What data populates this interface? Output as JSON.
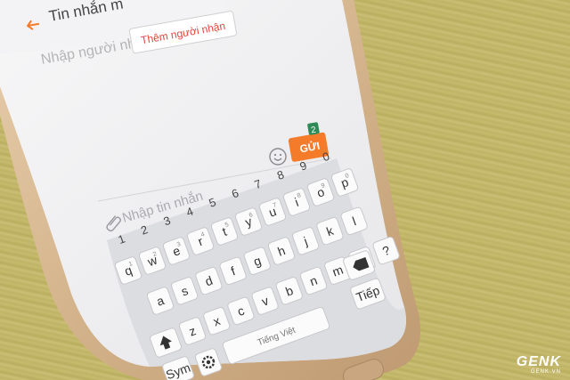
{
  "app": {
    "header_title": "Tin nhắn m",
    "back_icon": "arrow-left-icon"
  },
  "recipient": {
    "placeholder": "Nhập người nhận",
    "tooltip": "Thêm người nhận"
  },
  "compose": {
    "placeholder": "Nhập tin nhắn",
    "send_label": "GỬI",
    "send_badge": "2",
    "emoji_icon": "smiley-icon",
    "attach_icon": "paperclip-icon"
  },
  "keyboard": {
    "number_row": [
      "1",
      "2",
      "3",
      "4",
      "5",
      "6",
      "7",
      "8",
      "9",
      "0"
    ],
    "row1": [
      "q",
      "w",
      "e",
      "r",
      "t",
      "y",
      "u",
      "i",
      "o",
      "p"
    ],
    "row1_sub": [
      "1",
      "2",
      "3",
      "4",
      "5",
      "6",
      "7",
      "8",
      "9",
      "0"
    ],
    "row2": [
      "a",
      "s",
      "d",
      "f",
      "g",
      "h",
      "j",
      "k",
      "l"
    ],
    "row3": [
      "z",
      "x",
      "c",
      "v",
      "b",
      "n",
      "m",
      ".",
      "?"
    ],
    "sym_label": "Sym",
    "space_label": "Tiếng Việt",
    "enter_label": "Tiếp",
    "shift_icon": "shift-arrow-icon",
    "backspace_icon": "backspace-icon",
    "settings_icon": "gear-icon"
  },
  "colors": {
    "accent": "#f47b2a",
    "tooltip_text": "#e8453c",
    "badge": "#2e8b57"
  },
  "watermark": {
    "brand": "GENK",
    "site": "GENK.VN"
  }
}
